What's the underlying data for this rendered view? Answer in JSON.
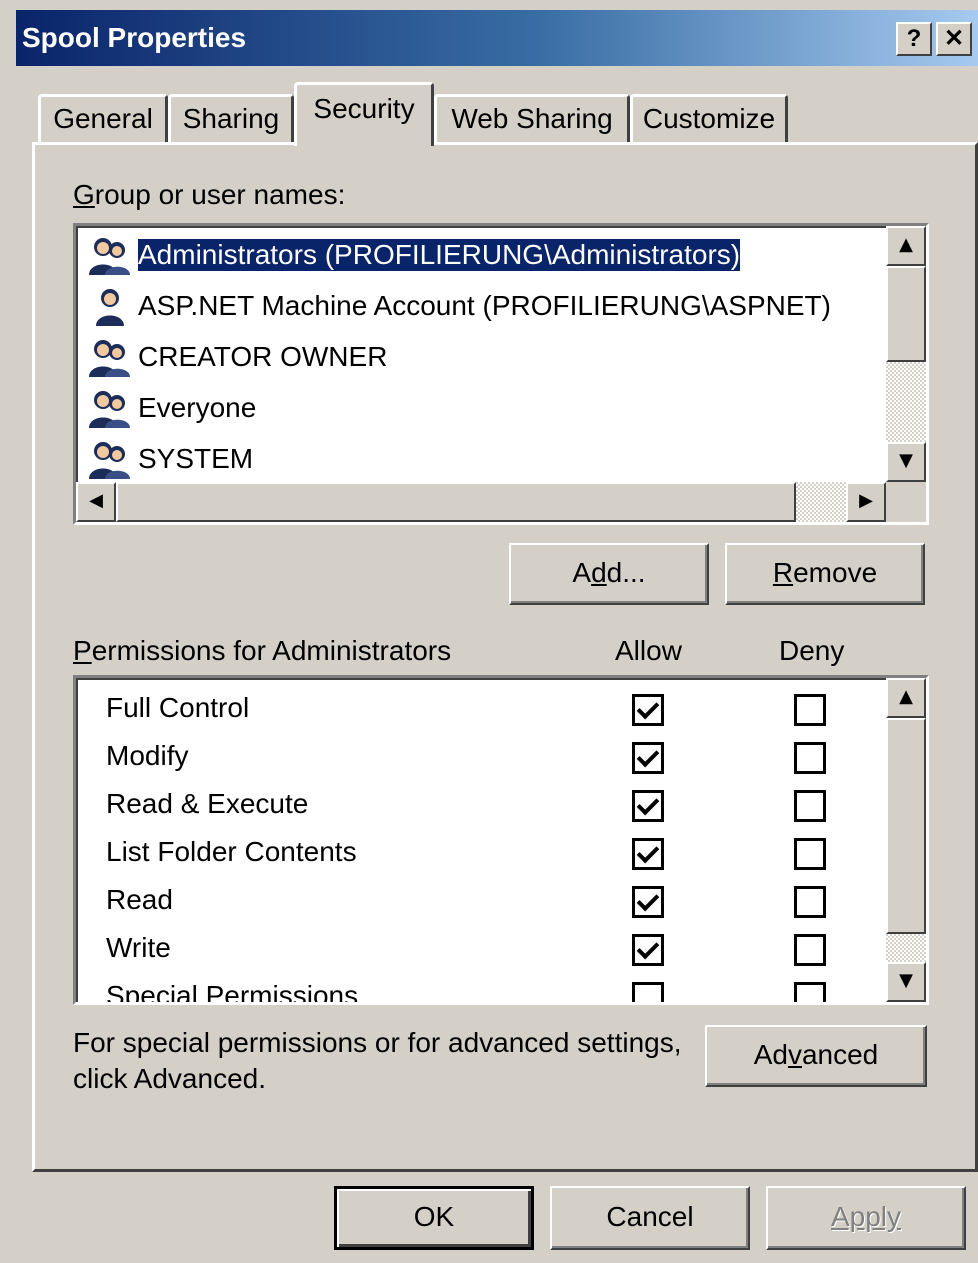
{
  "window": {
    "title": "Spool Properties",
    "help_label": "?",
    "close_label": "✕"
  },
  "tabs": [
    {
      "label": "General",
      "active": false
    },
    {
      "label": "Sharing",
      "active": false
    },
    {
      "label": "Security",
      "active": true
    },
    {
      "label": "Web Sharing",
      "active": false
    },
    {
      "label": "Customize",
      "active": false
    }
  ],
  "group_section": {
    "label_prefix": "G",
    "label_rest": "roup or user names:",
    "users": [
      {
        "name": "Administrators (PROFILIERUNG\\Administrators)",
        "icon": "group-icon",
        "selected": true
      },
      {
        "name": "ASP.NET Machine Account (PROFILIERUNG\\ASPNET)",
        "icon": "user-icon",
        "selected": false
      },
      {
        "name": "CREATOR OWNER",
        "icon": "group-icon",
        "selected": false
      },
      {
        "name": "Everyone",
        "icon": "group-icon",
        "selected": false
      },
      {
        "name": "SYSTEM",
        "icon": "group-icon",
        "selected": false
      }
    ],
    "add_a": "A",
    "add_d": "d",
    "add_rest": "d...",
    "remove_prefix": "R",
    "remove_rest": "emove"
  },
  "permissions": {
    "label_prefix": "P",
    "label_rest": "ermissions for Administrators",
    "allow_header": "Allow",
    "deny_header": "Deny",
    "rows": [
      {
        "name": "Full Control",
        "allow": true,
        "deny": false
      },
      {
        "name": "Modify",
        "allow": true,
        "deny": false
      },
      {
        "name": "Read & Execute",
        "allow": true,
        "deny": false
      },
      {
        "name": "List Folder Contents",
        "allow": true,
        "deny": false
      },
      {
        "name": "Read",
        "allow": true,
        "deny": false
      },
      {
        "name": "Write",
        "allow": true,
        "deny": false
      },
      {
        "name": "Special Permissions",
        "allow": false,
        "deny": false
      }
    ]
  },
  "advanced": {
    "hint_line1": "For special permissions or for advanced settings,",
    "hint_line2": "click Advanced.",
    "button_pre": "Ad",
    "button_ul": "v",
    "button_post": "anced"
  },
  "footer": {
    "ok_label": "OK",
    "cancel_label": "Cancel",
    "apply_label": "Apply"
  }
}
